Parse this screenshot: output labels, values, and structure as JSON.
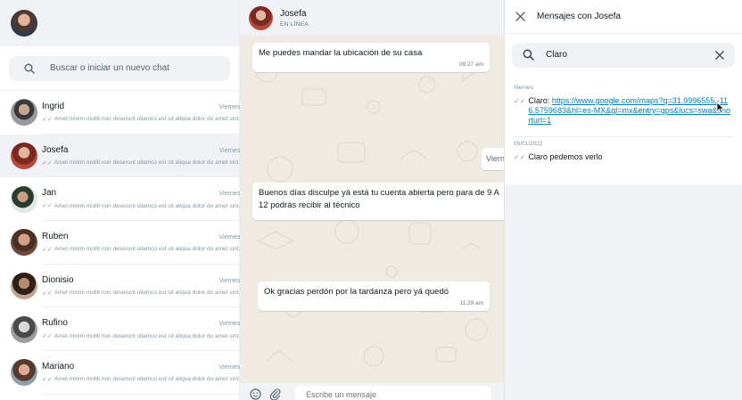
{
  "sidebar": {
    "search_placeholder": "Buscar o iniciar un nuevo chat",
    "chats": [
      {
        "name": "Ingrid",
        "time": "Viernes",
        "preview": "Amet minim mollit non deserunt ullamco est sit aliqua dolor do amet sint.",
        "active": false
      },
      {
        "name": "Josefa",
        "time": "Viernes",
        "preview": "Amet minim mollit non deserunt ullamco est sit aliqua dolor do amet sint.",
        "active": true
      },
      {
        "name": "Jan",
        "time": "Viernes",
        "preview": "Amet minim mollit non deserunt ullamco est sit aliqua dolor do amet sint.",
        "active": false
      },
      {
        "name": "Ruben",
        "time": "Viernes",
        "preview": "Amet minim mollit non deserunt ullamco est sit aliqua dolor do amet sint.",
        "active": false
      },
      {
        "name": "Dionisio",
        "time": "Viernes",
        "preview": "Amet minim mollit non deserunt ullamco est sit aliqua dolor do amet sint.",
        "active": false
      },
      {
        "name": "Rufino",
        "time": "Viernes",
        "preview": "Amet minim mollit non deserunt ullamco est sit aliqua dolor do amet sint.",
        "active": false
      },
      {
        "name": "Mariano",
        "time": "Viernes",
        "preview": "Amet minim mollit non deserunt ullamco est sit aliqua dolor do amet sint.",
        "active": false
      }
    ]
  },
  "chat": {
    "contact_name": "Josefa",
    "status": "EN LÍNEA",
    "messages": [
      {
        "text": "Me puedes mandar la ubicación de su casa",
        "time": "09:27 am"
      },
      {
        "text": "Buenos días disculpe yá está tu cuenta abierta pero para de 9 A 12 podrás recibir al técnico",
        "time": ""
      },
      {
        "text": "Ok gracias perdón por la tardanza pero yá quedó",
        "time": "11:29 am"
      }
    ],
    "day_chip": "Viern",
    "composer_placeholder": "Escribe un mensaje"
  },
  "search_panel": {
    "title": "Mensajes con Josefa",
    "query": "Claro",
    "results": [
      {
        "date": "Viernes",
        "prefix": "Claro: ",
        "link": "https://www.google.com/maps?q=31.9996555,-116.5759683&hl=es-MX&gl=mx&entry=gps&lucs=swa&shorturl=1",
        "text": ""
      },
      {
        "date": "05/01/2022",
        "prefix": "",
        "link": "",
        "text": "Claro pedemos verlo"
      }
    ]
  },
  "icons": {
    "me_avatar": "user-avatar",
    "search": "search-icon",
    "close": "close-icon",
    "clear": "clear-icon",
    "emoji": "emoji-icon",
    "attach": "paperclip-icon",
    "double_check": "double-check-icon"
  },
  "colors": {
    "header_bg": "#f0f2f5",
    "chat_bg": "#efeae2",
    "link": "#027eb5",
    "meta": "#8696a0"
  }
}
